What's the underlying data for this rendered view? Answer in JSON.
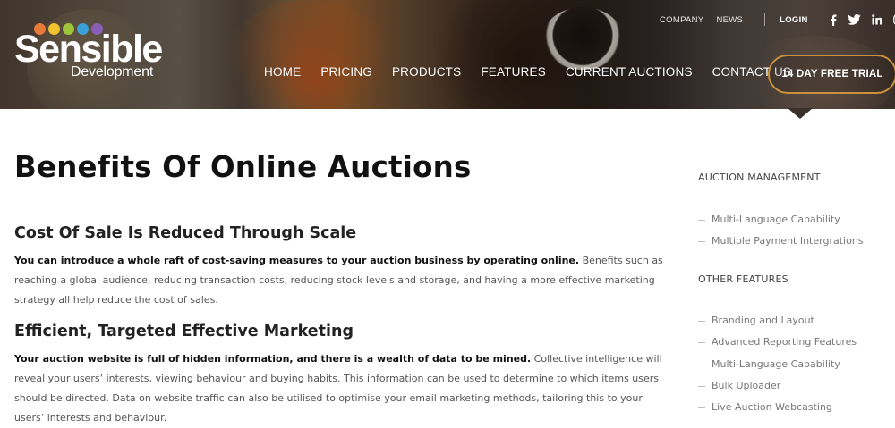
{
  "brand": {
    "name": "Sensible",
    "subname": "Development",
    "dot_colors": [
      "#e87a3a",
      "#f2c230",
      "#9fc43a",
      "#3aa0d8",
      "#8a5fb5"
    ]
  },
  "top_links": {
    "company": "COMPANY",
    "news": "NEWS",
    "login": "LOGIN"
  },
  "social": [
    "facebook-icon",
    "twitter-icon",
    "linkedin-icon",
    "instagram-icon"
  ],
  "nav": {
    "items": [
      "HOME",
      "PRICING",
      "PRODUCTS",
      "FEATURES",
      "CURRENT AUCTIONS",
      "CONTACT US"
    ],
    "cta": "14 DAY FREE TRIAL"
  },
  "colors": {
    "cta_border": "#c9913b",
    "text_dark": "#111111"
  },
  "main": {
    "title": "Benefits Of Online Auctions",
    "sections": [
      {
        "heading": "Cost Of Sale Is Reduced Through Scale",
        "lead": "You can introduce a whole raft of cost-saving measures to your auction business by operating online.",
        "body": " Benefits such as reaching a global audience, reducing transaction costs, reducing stock levels and storage, and having a more effective marketing strategy all help reduce the cost of sales."
      },
      {
        "heading": "Efficient, Targeted Effective Marketing",
        "lead": "Your auction website is full of hidden information, and there is a wealth of data to be mined.",
        "body": " Collective intelligence will reveal your users’ interests, viewing behaviour and buying habits. This information can be used to determine to which items users should be directed. Data on website traffic can also be utilised to optimise your email marketing methods, tailoring this to your users’ interests and behaviour."
      }
    ]
  },
  "sidebar": {
    "groups": [
      {
        "heading": "AUCTION MANAGEMENT",
        "items": [
          "Multi-Language Capability",
          "Multiple Payment Intergrations"
        ]
      },
      {
        "heading": "OTHER FEATURES",
        "items": [
          "Branding and Layout",
          "Advanced Reporting Features",
          "Multi-Language Capability",
          "Bulk Uploader",
          "Live Auction Webcasting"
        ]
      }
    ]
  }
}
